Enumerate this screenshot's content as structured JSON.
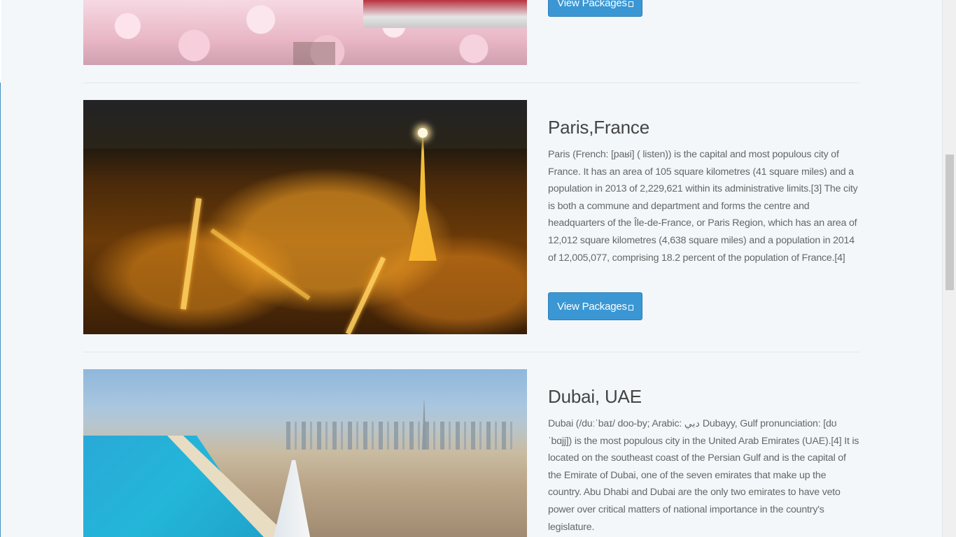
{
  "destinations": [
    {
      "id": "sakura",
      "button_label": "View Packages"
    },
    {
      "id": "paris",
      "title": "Paris,France",
      "description": "Paris (French: [paʁi] ( listen)) is the capital and most populous city of France. It has an area of 105 square kilometres (41 square miles) and a population in 2013 of 2,229,621 within its administrative limits.[3] The city is both a commune and department and forms the centre and headquarters of the Île-de-France, or Paris Region, which has an area of 12,012 square kilometres (4,638 square miles) and a population in 2014 of 12,005,077, comprising 18.2 percent of the population of France.[4]",
      "button_label": "View Packages"
    },
    {
      "id": "dubai",
      "title": "Dubai, UAE",
      "description": "Dubai (/duːˈbaɪ/ doo-by; Arabic: دبي‎ Dubayy, Gulf pronunciation: [dʊ ˈbɑjj]) is the most populous city in the United Arab Emirates (UAE).[4] It is located on the southeast coast of the Persian Gulf and is the capital of the Emirate of Dubai, one of the seven emirates that make up the country. Abu Dhabi and Dubai are the only two emirates to have veto power over critical matters of national importance in the country's legislature."
    }
  ],
  "icons": {
    "button_glyph": "external-link-icon"
  }
}
